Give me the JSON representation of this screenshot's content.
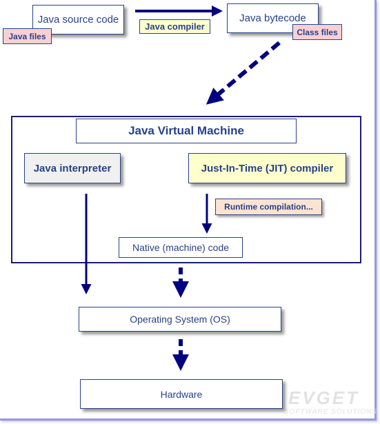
{
  "source": {
    "label": "Java source code",
    "tag": "Java files"
  },
  "compiler": {
    "label": "Java compiler"
  },
  "bytecode": {
    "label": "Java bytecode",
    "tag": "Class files"
  },
  "jvm": {
    "title": "Java Virtual Machine",
    "interpreter": "Java interpreter",
    "jit": "Just-In-Time (JIT) compiler",
    "runtime": "Runtime compilation...",
    "native": "Native (machine) code"
  },
  "os": {
    "label": "Operating System (OS)"
  },
  "hardware": {
    "label": "Hardware"
  },
  "watermark": {
    "brand": "EVGET",
    "tagline": "SOFTWARE SOLUTIONS"
  },
  "colors": {
    "navy": "#000080",
    "pink": "#f8d0d4",
    "yellow": "#ffffcc",
    "grey": "#f0f0f0",
    "beige": "#fbe3d2"
  }
}
